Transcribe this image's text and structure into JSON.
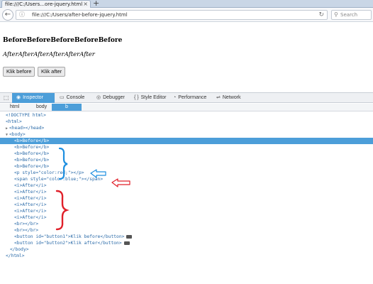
{
  "browser": {
    "tab_title": "file:///C:/Users...ore-jquery.html",
    "tab_close": "×",
    "new_tab": "+",
    "url": "file:///C:/Users/after-before-jquery.html",
    "search_placeholder": "Search"
  },
  "page": {
    "before_text": "BeforeBeforeBeforeBeforeBefore",
    "after_text": "AfterAfterAfterAfterAfterAfter",
    "button1_label": "Klik before",
    "button2_label": "Klik after"
  },
  "devtools": {
    "tabs": [
      {
        "label": "Inspector",
        "icon": "inspector-icon",
        "active": true
      },
      {
        "label": "Console",
        "icon": "console-icon"
      },
      {
        "label": "Debugger",
        "icon": "debugger-icon"
      },
      {
        "label": "Style Editor",
        "icon": "style-editor-icon"
      },
      {
        "label": "Performance",
        "icon": "performance-icon"
      },
      {
        "label": "Network",
        "icon": "network-icon"
      }
    ],
    "breadcrumbs": [
      "html",
      "body",
      "b"
    ],
    "markup": [
      "<!DOCTYPE html>",
      "<html>",
      "<head></head>",
      "<body>",
      "<b>Before</b>",
      "<b>Before</b>",
      "<b>Before</b>",
      "<b>Before</b>",
      "<b>Before</b>",
      "<p style=\"color:red;\"></p>",
      "<span style=\"color:blue;\"></span>",
      "<i>After</i>",
      "<i>After</i>",
      "<i>After</i>",
      "<i>After</i>",
      "<i>After</i>",
      "<i>After</i>",
      "<br></br>",
      "<br></br>",
      "<button id=\"button1\">Klik before</button>",
      "<button id=\"button2\">Klik after</button>",
      "</body>",
      "</html>"
    ],
    "accent_color": "#4c9ed9"
  },
  "annotations": {
    "brace_blue_color": "#1e8fe0",
    "brace_red_color": "#e0202a",
    "arrow_blue_color": "#1e8fe0",
    "arrow_red_color": "#e0202a"
  }
}
